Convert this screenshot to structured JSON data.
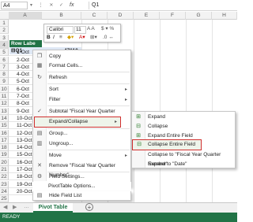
{
  "formula_bar": {
    "name_box": "A4",
    "fx": "fx",
    "value": "Q1"
  },
  "columns": [
    "A",
    "B",
    "C",
    "D",
    "E",
    "F",
    "G",
    "H"
  ],
  "rows": [
    "1",
    "2",
    "3",
    "4",
    "5",
    "6",
    "7",
    "8",
    "9",
    "10",
    "11",
    "12",
    "13",
    "14",
    "15",
    "16",
    "17",
    "18",
    "19",
    "20",
    "21",
    "22",
    "23",
    "24",
    "25"
  ],
  "cells": {
    "row_labels": "Row Labe",
    "q1": "⊟Q1",
    "b4": "47110",
    "dates": [
      "1-Oct",
      "2-Oct",
      "3-Oct",
      "4-Oct",
      "5-Oct",
      "6-Oct",
      "7-Oct",
      "8-Oct",
      "9-Oct",
      "10-Oct",
      "11-Oct",
      "12-Oct",
      "13-Oct",
      "14-Oct",
      "15-Oct",
      "16-Oct",
      "17-Oct",
      "18-Oct",
      "19-Oct",
      "20-Oct"
    ]
  },
  "mini_toolbar": {
    "font": "Calibri",
    "size": "11",
    "bold": "B",
    "italic": "I"
  },
  "context_menu": {
    "items": [
      "Copy",
      "Format Cells...",
      "Refresh",
      "Sort",
      "Filter",
      "Subtotal \"Fiscal Year Quarter Number\"",
      "Expand/Collapse",
      "Group...",
      "Ungroup...",
      "Move",
      "Remove \"Fiscal Year Quarter Number\"",
      "Field Settings...",
      "PivotTable Options...",
      "Hide Field List"
    ]
  },
  "submenu": {
    "items": [
      "Expand",
      "Collapse",
      "Expand Entire Field",
      "Collapse Entire Field",
      "Collapse to \"Fiscal Year Quarter Number\"",
      "Expand to \"Date\""
    ]
  },
  "sheet_tab": "Pivot Table",
  "status": "READY",
  "colors": {
    "accent": "#217346",
    "highlight_border": "#d0302f"
  }
}
